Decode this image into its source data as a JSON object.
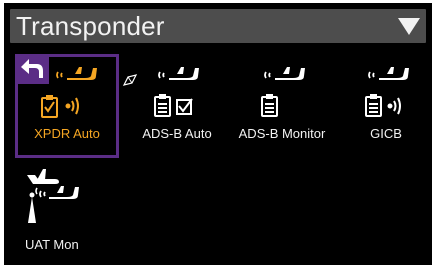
{
  "window": {
    "title": "Transponder",
    "dropdown_icon": "caret-down-icon"
  },
  "accent_color": "#f5a623",
  "selection_color": "#5b2d86",
  "tiles": [
    {
      "label": "XPDR Auto",
      "selected": true,
      "icons": [
        "back-arrow-icon",
        "aircraft-signal-icon",
        "clipboard-check-icon",
        "signal-waves-icon"
      ]
    },
    {
      "label": "ADS-B Auto",
      "selected": false,
      "icons": [
        "aircraft-signal-icon",
        "clipboard-icon",
        "checkbox-checked-icon"
      ]
    },
    {
      "label": "ADS-B Monitor",
      "selected": false,
      "icons": [
        "aircraft-signal-icon",
        "clipboard-icon"
      ]
    },
    {
      "label": "GICB",
      "selected": false,
      "icons": [
        "aircraft-signal-icon",
        "clipboard-icon",
        "signal-waves-icon"
      ]
    },
    {
      "label": "UAT Mon",
      "selected": false,
      "icons": [
        "aircraft-icon",
        "antenna-icon",
        "aircraft-signal-icon"
      ]
    }
  ]
}
